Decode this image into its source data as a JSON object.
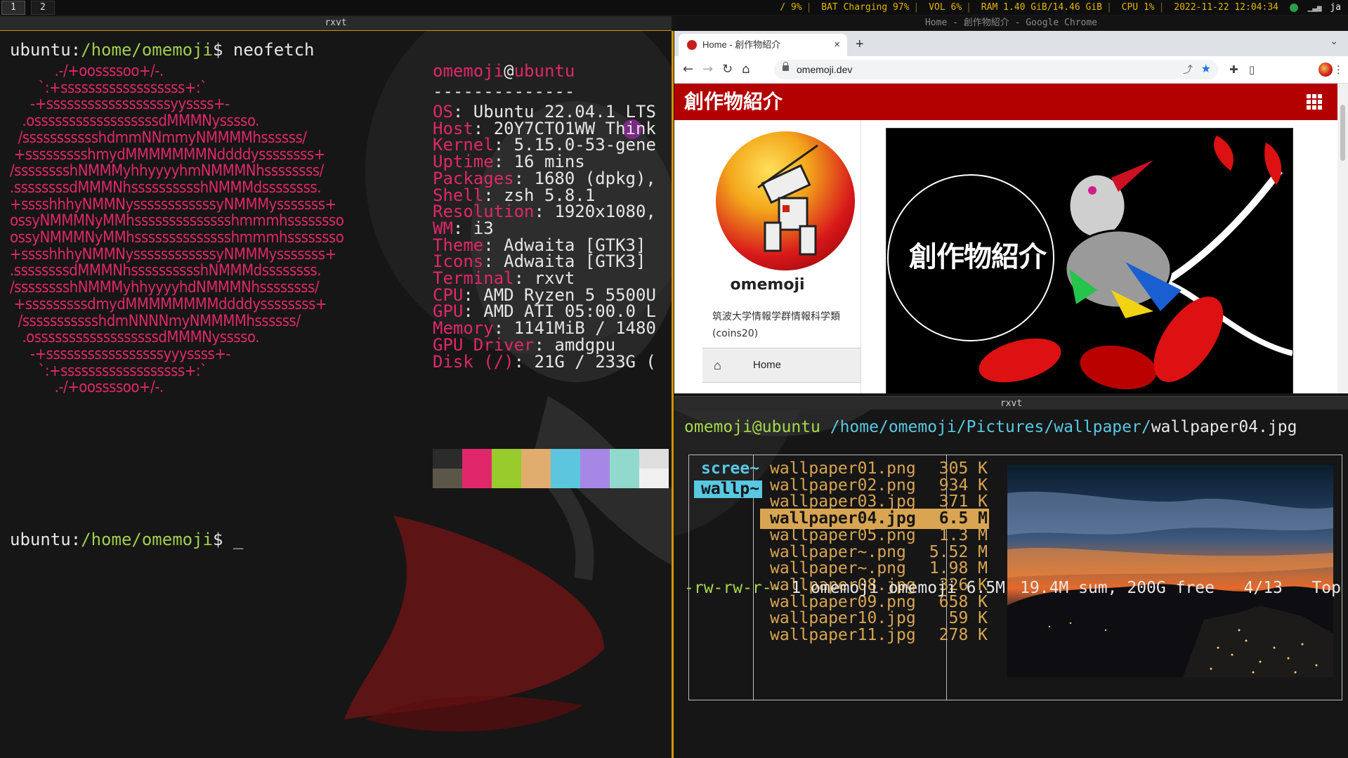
{
  "bar": {
    "workspaces": [
      "1",
      "2"
    ],
    "status": {
      "disk": "/ 9%",
      "battery": "BAT Charging 97%",
      "volume": "VOL 6%",
      "ram": "RAM 1.40 GiB/14.46 GiB",
      "cpu": "CPU  1%",
      "datetime": "2022-11-22 12:04:34",
      "lang": "ja"
    }
  },
  "left_window": {
    "title": "rxvt",
    "prompt_user": "ubuntu",
    "prompt_path": "/home/omemoji",
    "prompt_symbol": "$",
    "command": "neofetch",
    "cursor": "_",
    "logo_lines": [
      "           .-/+oossssoo+/-.",
      "       `:+ssssssssssssssssss+:`",
      "     -+ssssssssssssssssssyyssss+-",
      "   .ossssssssssssssssssdMMMNysssso.",
      "  /ssssssssssshdmmNNmmyNMMMMhssssss/",
      " +ssssssssshmydMMMMMMMNddddyssssssss+",
      "/sssssssshNMMMyhhyyyyhmNMMMNhssssssss/",
      ".ssssssssdMMMNhsssssssssshNMMMdssssssss.",
      "+sssshhhyNMMNyssssssssssssyNMMMysssssss+",
      "ossyNMMMNyMMhsssssssssssssshmmmhssssssso",
      "ossyNMMMNyMMhsssssssssssssshmmmhssssssso",
      "+sssshhhyNMMNyssssssssssssyNMMMysssssss+",
      ".ssssssssdMMMNhsssssssssshNMMMdssssssss.",
      "/sssssssshNMMMyhhyyyyhdNMMMNhssssssss/",
      " +sssssssssdmydMMMMMMMMddddyssssssss+",
      "  /ssssssssssshdmNNNNmyNMMMMhssssss/",
      "   .ossssssssssssssssssdMMMNysssso.",
      "     -+sssssssssssssssssyyyssss+-",
      "       `:+ssssssssssssssssss+:`",
      "           .-/+oossssoo+/-."
    ],
    "info_user": "omemoji",
    "info_at": "@",
    "info_host": "ubuntu",
    "info_rule": "--------------",
    "info": [
      {
        "key": "OS",
        "value": ": Ubuntu 22.04.1 LTS"
      },
      {
        "key": "Host",
        "value": ": 20Y7CTO1WW Think"
      },
      {
        "key": "Kernel",
        "value": ": 5.15.0-53-gene"
      },
      {
        "key": "Uptime",
        "value": ": 16 mins"
      },
      {
        "key": "Packages",
        "value": ": 1680 (dpkg),"
      },
      {
        "key": "Shell",
        "value": ": zsh 5.8.1"
      },
      {
        "key": "Resolution",
        "value": ": 1920x1080,"
      },
      {
        "key": "WM",
        "value": ": i3"
      },
      {
        "key": "Theme",
        "value": ": Adwaita [GTK3]"
      },
      {
        "key": "Icons",
        "value": ": Adwaita [GTK3]"
      },
      {
        "key": "Terminal",
        "value": ": rxvt"
      },
      {
        "key": "CPU",
        "value": ": AMD Ryzen 5 5500U"
      },
      {
        "key": "GPU",
        "value": ": AMD ATI 05:00.0 L"
      },
      {
        "key": "Memory",
        "value": ": 1141MiB / 1480"
      },
      {
        "key": "GPU Driver",
        "value": ": amdgpu"
      },
      {
        "key": "Disk (/)",
        "value": ": 21G / 233G ("
      }
    ],
    "palette_top": [
      "#2b2b2b",
      "#e0276a",
      "#98cb2c",
      "#e0ad6e",
      "#5bc6de",
      "#a787e6",
      "#92d9cd",
      "#dedede"
    ],
    "palette_bottom": [
      "#5c5648",
      "#e0276a",
      "#98cb2c",
      "#e0ad6e",
      "#5bc6de",
      "#a787e6",
      "#92d9cd",
      "#f0f0f0"
    ]
  },
  "chrome": {
    "window_title": "Home - 創作物紹介 - Google Chrome",
    "tab_label": "Home - 創作物紹介",
    "tab_close": "×",
    "new_tab": "+",
    "tab_menu": "⌄",
    "url": "omemoji.dev",
    "site": {
      "title": "創作物紹介",
      "username": "omemoji",
      "affiliation": "筑波大学情報学群情報科学類(coins20)",
      "nav_home": "Home",
      "banner_text": "創作物紹介"
    }
  },
  "ranger": {
    "title": "rxvt",
    "header_user_host": "omemoji@ubuntu",
    "header_path": "/home/omemoji/Pictures/wallpaper/",
    "header_file": "wallpaper04.jpg",
    "parent_items": [
      "scree~",
      "wallp~"
    ],
    "files": [
      {
        "name": "wallpaper01.png",
        "size": "305 K"
      },
      {
        "name": "wallpaper02.png",
        "size": "934 K"
      },
      {
        "name": "wallpaper03.jpg",
        "size": "371 K"
      },
      {
        "name": "wallpaper04.jpg",
        "size": "6.5 M"
      },
      {
        "name": "wallpaper05.png",
        "size": "1.3 M"
      },
      {
        "name": "wallpaper~.png",
        "size": "5.52 M"
      },
      {
        "name": "wallpaper~.png",
        "size": "1.98 M"
      },
      {
        "name": "wallpaper08.jpg",
        "size": "326 K"
      },
      {
        "name": "wallpaper09.png",
        "size": "658 K"
      },
      {
        "name": "wallpaper10.jpg",
        "size": " 59 K"
      },
      {
        "name": "wallpaper11.jpg",
        "size": "278 K"
      }
    ],
    "selected_index": 3,
    "status_perms": "-rw-rw-r--",
    "status_info": " 1 omemoji omemoji 6.5M",
    "status_right": "19.4M sum, 200G free   4/13   Top"
  }
}
